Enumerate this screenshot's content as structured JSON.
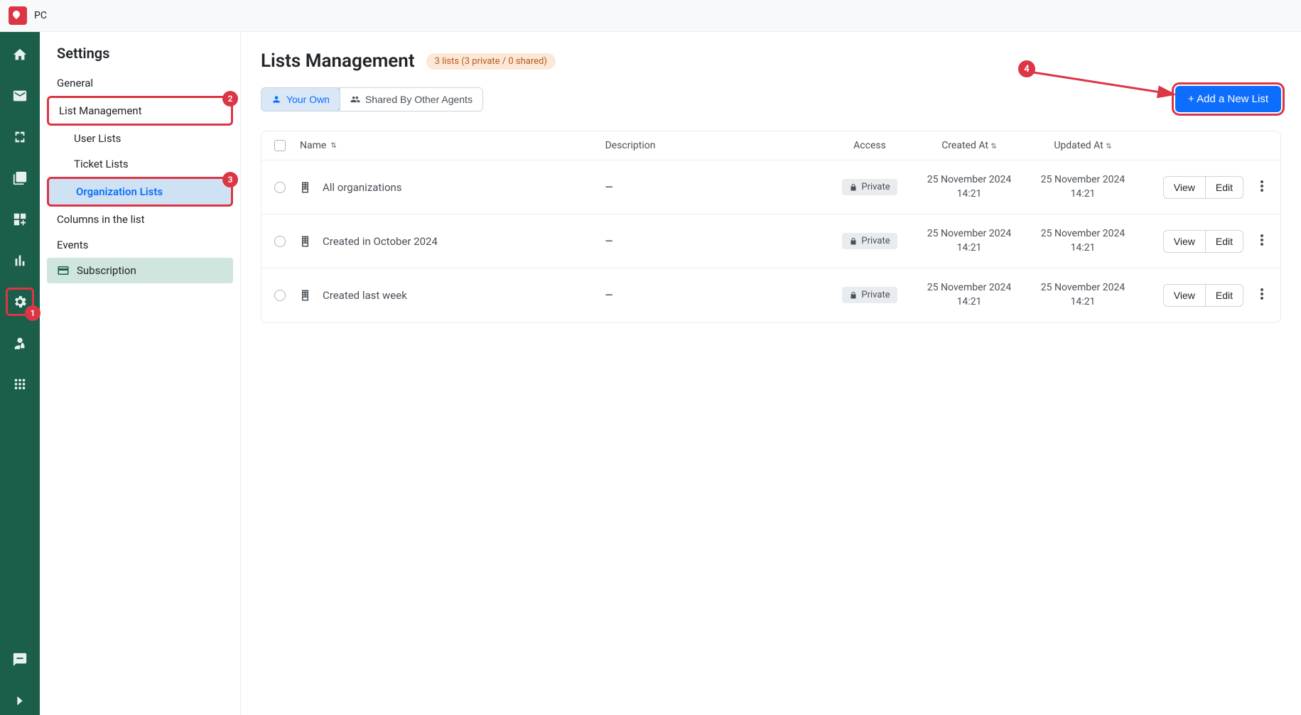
{
  "topbar": {
    "title": "PC"
  },
  "rail": {
    "items": [
      {
        "name": "home-icon"
      },
      {
        "name": "mail-icon"
      },
      {
        "name": "sync-icon"
      },
      {
        "name": "book-icon"
      },
      {
        "name": "apps-add-icon"
      },
      {
        "name": "chart-icon"
      },
      {
        "name": "gear-icon",
        "active": true,
        "annot": "1"
      },
      {
        "name": "user-lock-icon"
      },
      {
        "name": "grid-icon"
      }
    ],
    "bottom": [
      {
        "name": "chat-icon"
      },
      {
        "name": "chevron-right-icon"
      }
    ]
  },
  "sidebar": {
    "title": "Settings",
    "items": [
      {
        "label": "General"
      },
      {
        "label": "List Management",
        "highlight": true,
        "annot": "2"
      },
      {
        "label": "User Lists",
        "sub": true
      },
      {
        "label": "Ticket Lists",
        "sub": true
      },
      {
        "label": "Organization Lists",
        "sub": true,
        "active": true,
        "highlight": true,
        "annot": "3"
      },
      {
        "label": "Columns in the list"
      },
      {
        "label": "Events"
      },
      {
        "label": "Subscription",
        "icon": true,
        "subs": true
      }
    ]
  },
  "main": {
    "title": "Lists Management",
    "summary": "3 lists (3 private / 0 shared)",
    "tabs": {
      "own": "Your Own",
      "shared": "Shared By Other Agents"
    },
    "add_button": "+ Add a New List",
    "add_annot": "4",
    "columns": {
      "name": "Name",
      "description": "Description",
      "access": "Access",
      "created": "Created At",
      "updated": "Updated At"
    },
    "actions": {
      "view": "View",
      "edit": "Edit"
    },
    "access_label": "Private",
    "rows": [
      {
        "name": "All organizations",
        "desc": "—",
        "created_date": "25 November 2024",
        "created_time": "14:21",
        "updated_date": "25 November 2024",
        "updated_time": "14:21"
      },
      {
        "name": "Created in October 2024",
        "desc": "—",
        "created_date": "25 November 2024",
        "created_time": "14:21",
        "updated_date": "25 November 2024",
        "updated_time": "14:21"
      },
      {
        "name": "Created last week",
        "desc": "—",
        "created_date": "25 November 2024",
        "created_time": "14:21",
        "updated_date": "25 November 2024",
        "updated_time": "14:21"
      }
    ]
  }
}
